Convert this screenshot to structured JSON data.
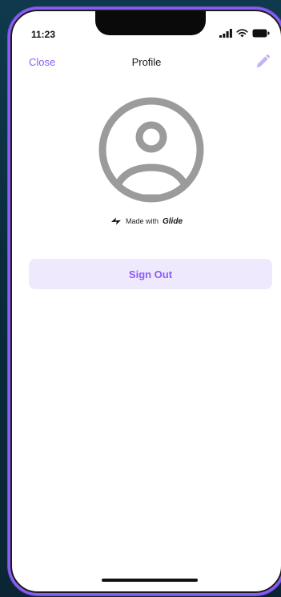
{
  "status_bar": {
    "time": "11:23",
    "icons": [
      "signal-icon",
      "wifi-icon",
      "battery-icon"
    ]
  },
  "header": {
    "close_label": "Close",
    "title": "Profile",
    "edit_icon": "pencil-icon"
  },
  "profile": {
    "avatar_icon": "user-circle-icon"
  },
  "footer_brand": {
    "prefix": "Made with",
    "brand": "Glide",
    "icon": "glide-bolt-icon"
  },
  "actions": {
    "sign_out_label": "Sign Out"
  },
  "colors": {
    "accent": "#8b5cf6",
    "accent_bg": "#efe9fe",
    "avatar_gray": "#9b9b9b"
  }
}
